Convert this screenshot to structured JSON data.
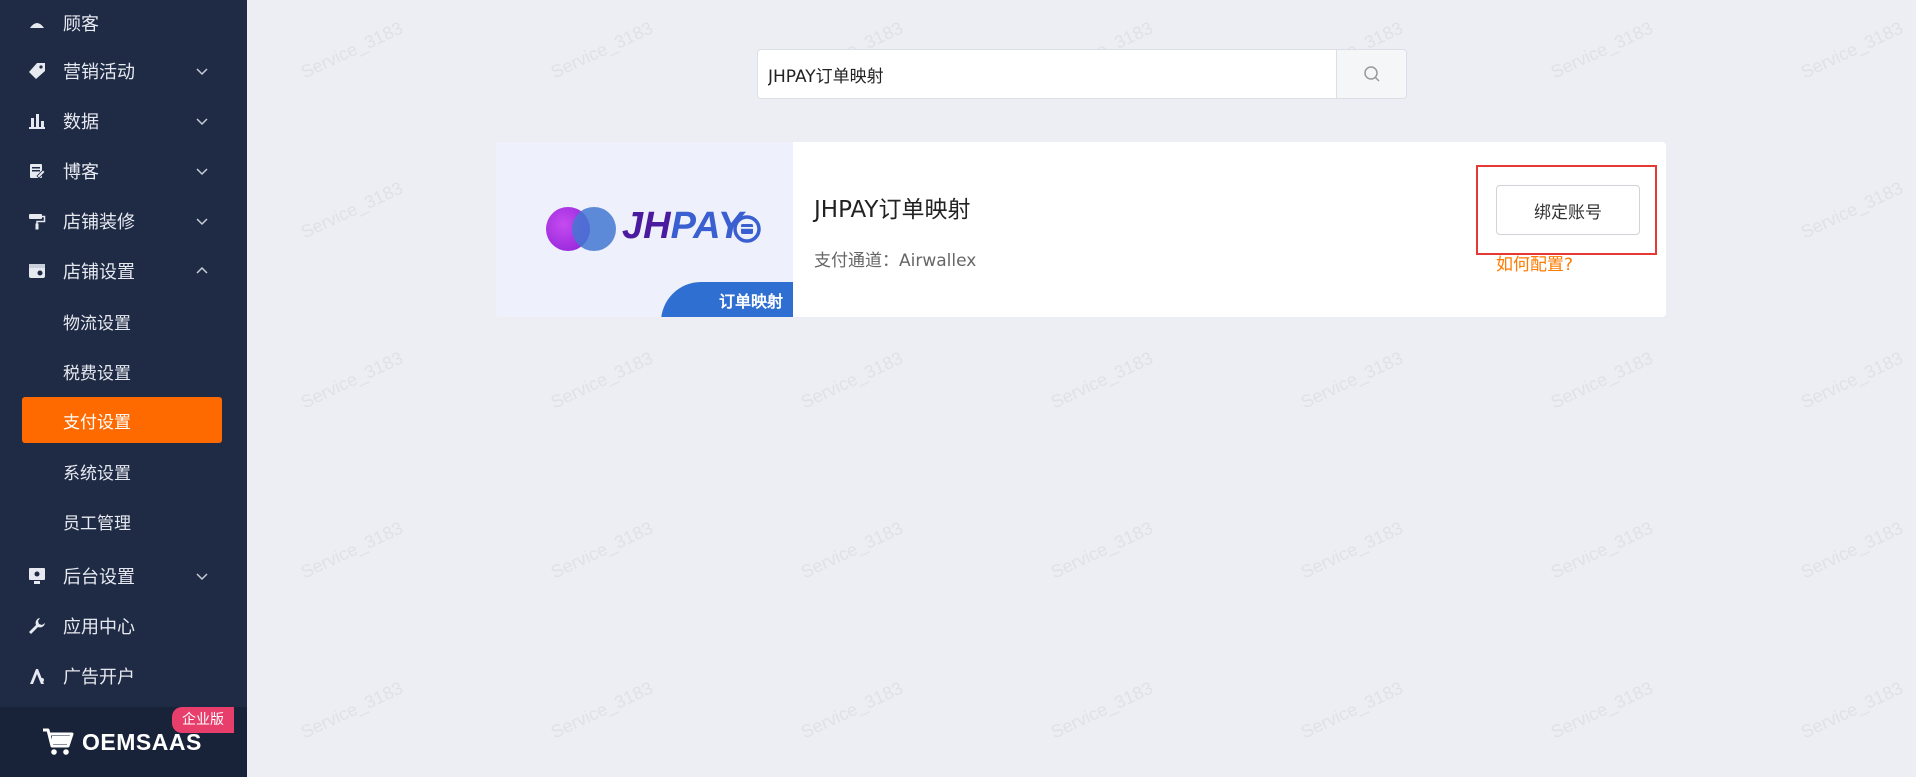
{
  "sidebar": {
    "items": [
      {
        "label": "顾客",
        "icon": "customers-icon",
        "has_chevron": false
      },
      {
        "label": "营销活动",
        "icon": "tag-icon",
        "has_chevron": true
      },
      {
        "label": "数据",
        "icon": "bar-chart-icon",
        "has_chevron": true
      },
      {
        "label": "博客",
        "icon": "blog-icon",
        "has_chevron": true
      },
      {
        "label": "店铺装修",
        "icon": "paint-roller-icon",
        "has_chevron": true
      },
      {
        "label": "店铺设置",
        "icon": "store-settings-icon",
        "has_chevron": true,
        "expanded": true
      }
    ],
    "submenu": [
      {
        "label": "物流设置"
      },
      {
        "label": "税费设置"
      },
      {
        "label": "支付设置",
        "active": true
      },
      {
        "label": "系统设置"
      },
      {
        "label": "员工管理"
      }
    ],
    "bottom_items": [
      {
        "label": "后台设置",
        "icon": "admin-settings-icon",
        "has_chevron": true
      },
      {
        "label": "应用中心",
        "icon": "wrench-icon",
        "has_chevron": false
      },
      {
        "label": "广告开户",
        "icon": "ads-icon",
        "has_chevron": false
      }
    ],
    "brand": {
      "name": "OEMSAAS",
      "badge": "企业版"
    }
  },
  "search": {
    "value": "JHPAY订单映射"
  },
  "card": {
    "logo_text_j": "JH",
    "logo_text_pay": "PAY",
    "tag": "订单映射",
    "title": "JHPAY订单映射",
    "channel": "支付通道：Airwallex",
    "bind_button": "绑定账号",
    "help_link": "如何配置?"
  },
  "watermark": "Service_3183",
  "colors": {
    "sidebar_bg": "#1f2a44",
    "active_orange": "#ff6a00",
    "badge_pink": "#e83e6c",
    "highlight_red": "#e53935",
    "link_orange": "#ff7a00"
  }
}
